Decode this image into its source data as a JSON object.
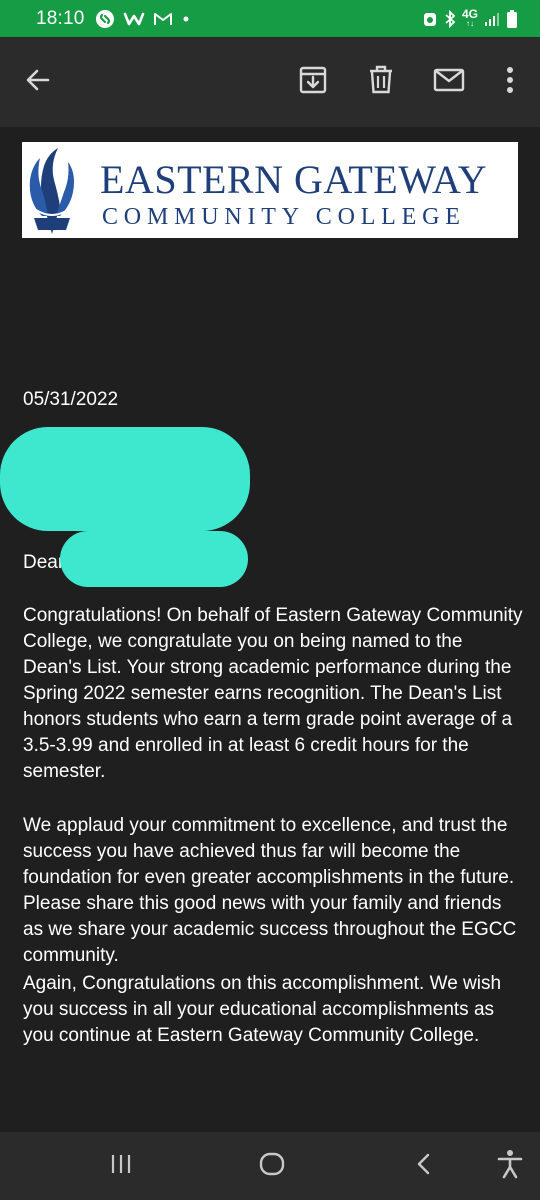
{
  "status_bar": {
    "time": "18:10",
    "network_label": "4G",
    "left_icons": [
      "shazam-icon",
      "w-app-icon",
      "gmail-icon",
      "dot-icon"
    ],
    "right_icons": [
      "alarm-icon",
      "bluetooth-icon",
      "network-icon",
      "signal-icon",
      "battery-icon"
    ],
    "background_color": "#169c44"
  },
  "toolbar": {
    "icons": [
      "back-arrow-icon",
      "archive-icon",
      "delete-icon",
      "mark-unread-icon",
      "more-vert-icon"
    ]
  },
  "email": {
    "logo": {
      "line1": "EASTERN GATEWAY",
      "line2": "COMMUNITY COLLEGE",
      "brand_color": "#1e3f7a"
    },
    "date": "05/31/2022",
    "salutation": "Dear",
    "paragraphs": [
      "Congratulations! On behalf of Eastern Gateway Community College, we congratulate you on being named to the Dean's List. Your strong academic performance during the Spring 2022 semester earns recognition. The Dean's List honors students who earn a term grade point average of a 3.5-3.99 and enrolled in at least 6 credit hours for the semester.",
      "We applaud your commitment to excellence, and trust the success you have achieved thus far will become the foundation for even greater accomplishments in the future. Please share this good news with your family and friends as we share your academic success throughout the EGCC community.",
      "Again, Congratulations on this accomplishment. We wish you success in all your educational accomplishments as you continue at Eastern Gateway Community College."
    ],
    "redaction_color": "#3de8cf"
  },
  "nav_bar": {
    "icons": [
      "recents-icon",
      "home-icon",
      "back-icon",
      "accessibility-icon"
    ]
  }
}
